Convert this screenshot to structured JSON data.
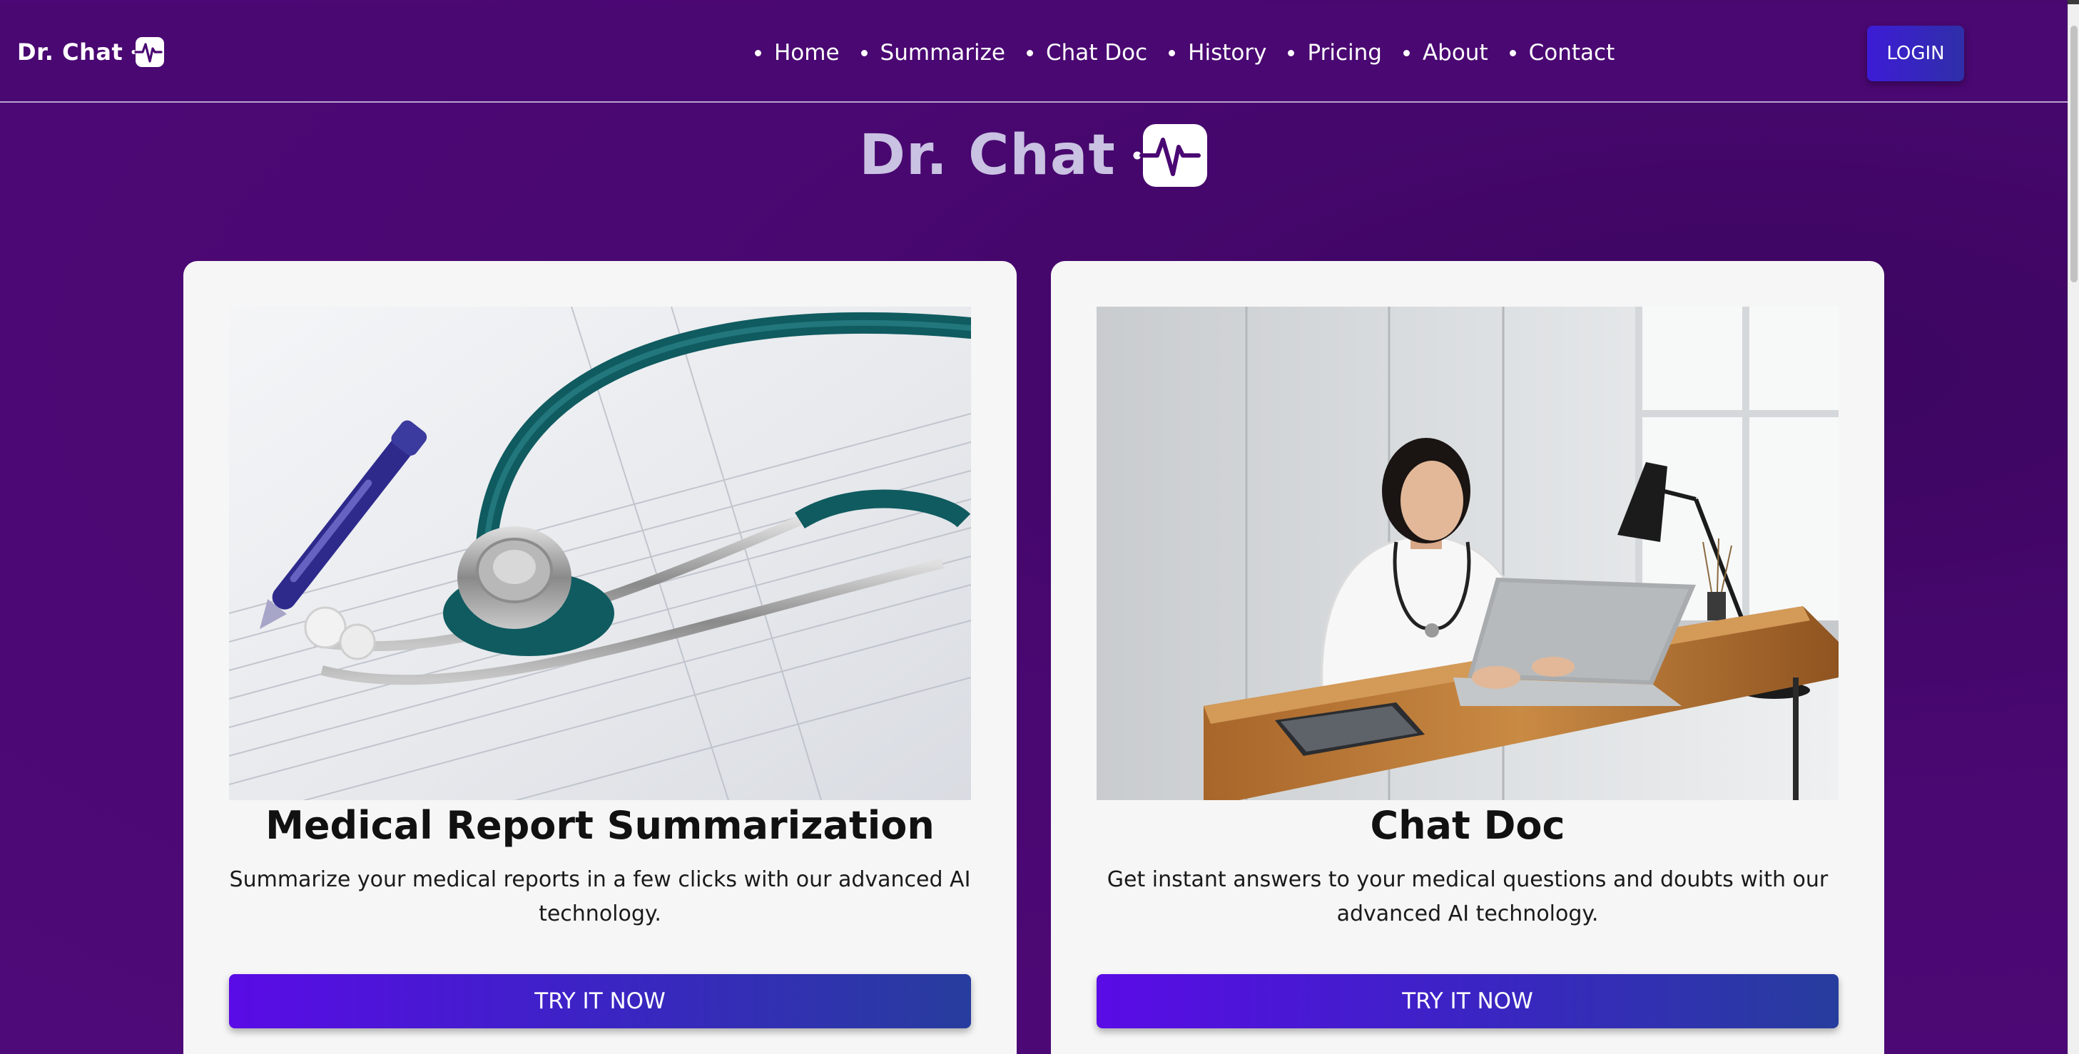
{
  "brand": {
    "name": "Dr. Chat",
    "logo_icon": "heartbeat-icon"
  },
  "nav": {
    "items": [
      {
        "label": "Home"
      },
      {
        "label": "Summarize"
      },
      {
        "label": "Chat Doc"
      },
      {
        "label": "History"
      },
      {
        "label": "Pricing"
      },
      {
        "label": "About"
      },
      {
        "label": "Contact"
      }
    ],
    "login_label": "LOGIN"
  },
  "hero": {
    "title": "Dr. Chat",
    "logo_icon": "heartbeat-icon"
  },
  "cards": [
    {
      "image": "stethoscope-on-medical-form-photo",
      "title": "Medical Report Summarization",
      "description": "Summarize your medical reports in a few clicks with our advanced AI technology.",
      "button_label": "TRY IT NOW"
    },
    {
      "image": "doctor-using-laptop-photo",
      "title": "Chat Doc",
      "description": "Get instant answers to your medical questions and doubts with our advanced AI technology.",
      "button_label": "TRY IT NOW"
    }
  ],
  "colors": {
    "background": "#4a0872",
    "card": "#f6f6f6",
    "button_start": "#5a0be6",
    "button_end": "#273d9e",
    "hero_title": "#c9c2e2"
  }
}
